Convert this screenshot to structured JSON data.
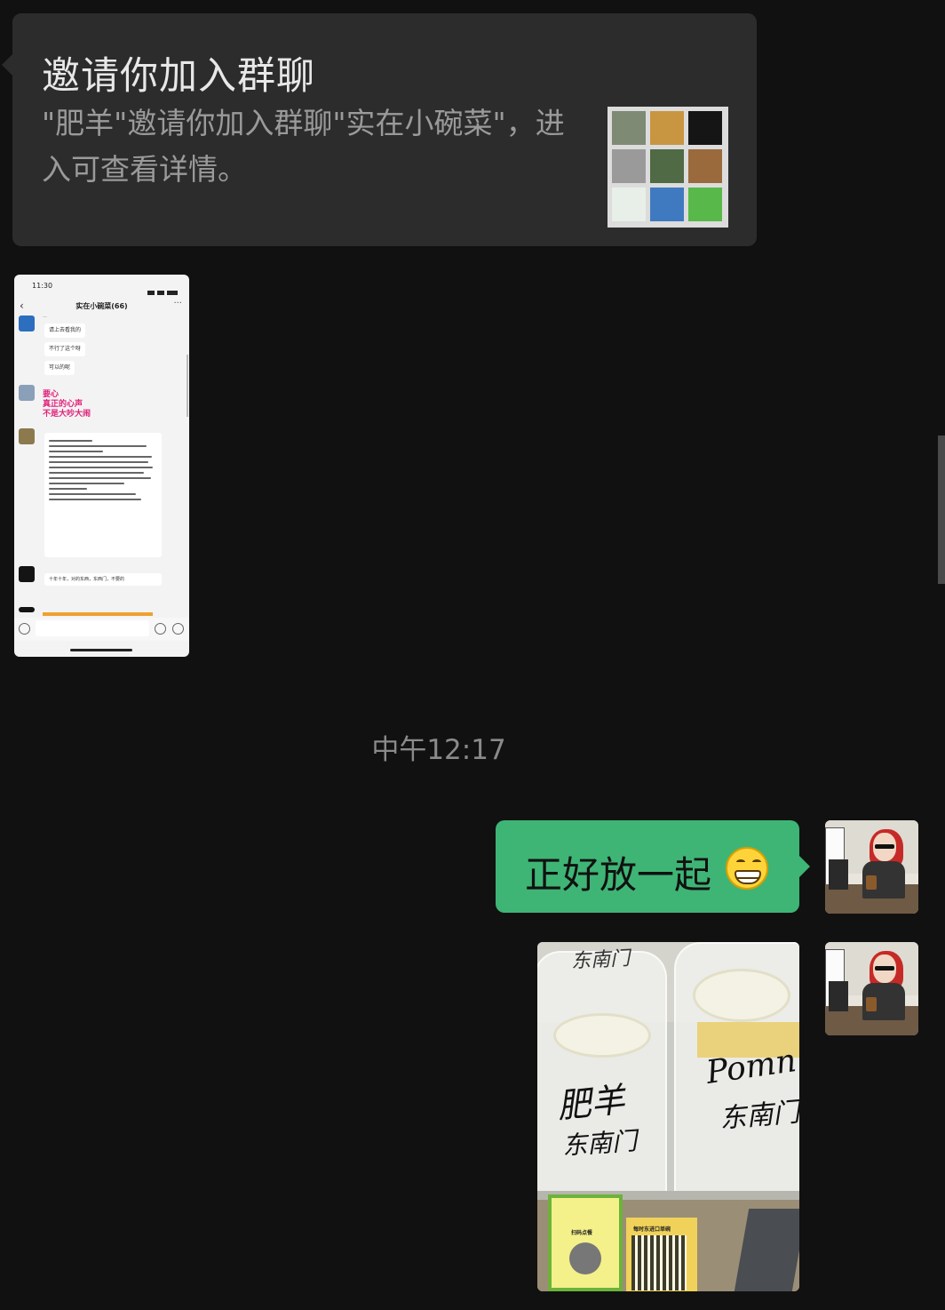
{
  "invite": {
    "title": "邀请你加入群聊",
    "description": "\"肥羊\"邀请你加入群聊\"实在小碗菜\"，进入可查看详情。",
    "avatar_grid_colors": [
      "#7e8a74",
      "#c89640",
      "#151515",
      "#9a9a9a",
      "#4f6a45",
      "#9a6a3c",
      "#e8efe8",
      "#3f7ac0",
      "#58b84a"
    ]
  },
  "screenshot_message": {
    "status_time": "11:30",
    "chat_title": "实在小碗菜(66)",
    "bubbles": [
      "请上去看我的",
      "不行了这个呀",
      "可以的呢"
    ],
    "red_lines": [
      "要心",
      "真正的心声",
      "不是大吵大闹"
    ],
    "last_bubble": "十年十年，对的东西，东西门，不要的"
  },
  "timestamp": "中午12:17",
  "sent_text": {
    "text": "正好放一起",
    "emoji": "grinning-face-emoji"
  },
  "photo_message": {
    "labels": [
      "肥羊",
      "东南门",
      "Pomn",
      "东南门",
      "东南门"
    ],
    "sign_labels": [
      "扫码点餐",
      "每时东进口单碗"
    ]
  }
}
